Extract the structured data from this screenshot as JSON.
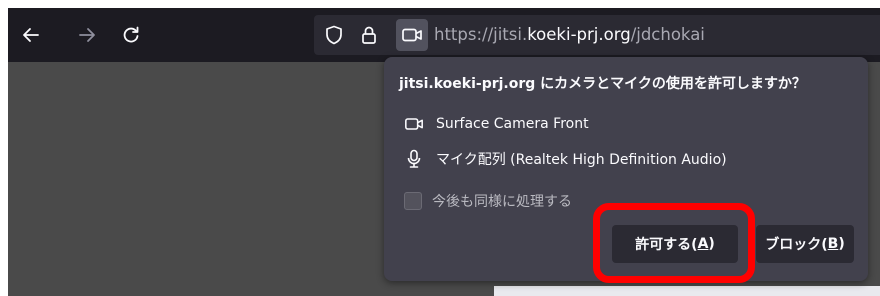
{
  "toolbar": {
    "back_icon": "arrow-left-icon",
    "forward_icon": "arrow-right-icon",
    "reload_icon": "reload-icon"
  },
  "urlbar": {
    "icons": [
      "shield-icon",
      "lock-icon",
      "camera-icon"
    ],
    "url_prefix": "https://jitsi.",
    "url_domain": "koeki-prj.org",
    "url_path": "/jdchokai"
  },
  "permission_popup": {
    "title": "jitsi.koeki-prj.org にカメラとマイクの使用を許可しますか？",
    "camera_device": "Surface Camera Front",
    "microphone_device": "マイク配列 (Realtek High Definition Audio)",
    "remember_label": "今後も同様に処理する",
    "remember_checked": false,
    "allow_label": "許可する(",
    "allow_accesskey": "A",
    "allow_suffix": ")",
    "block_label": "ブロック(",
    "block_accesskey": "B",
    "block_suffix": ")"
  },
  "colors": {
    "toolbar_bg": "#1c1b22",
    "urlbar_bg": "#2b2a33",
    "popup_bg": "#42414d",
    "highlight": "#ff0000"
  }
}
